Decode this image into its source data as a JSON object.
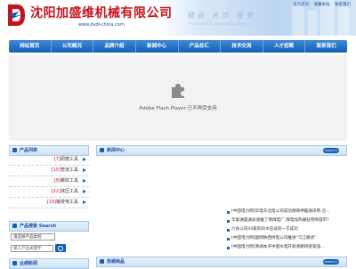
{
  "header": {
    "company_name": "沈阳加盛维机械有限公司",
    "site_url": "www.dvdl-china.com",
    "slogan": "精益 合作 服务",
    "slogan_sub": "Precision   Cooperation   Service",
    "top_links": [
      "设为首页",
      "收藏本站",
      "联系我们"
    ]
  },
  "nav": {
    "items": [
      "网站首页",
      "公司概况",
      "品牌介绍",
      "新闻中心",
      "产品总汇",
      "技术交流",
      "人才招聘",
      "联系我们"
    ]
  },
  "flash": {
    "message": "Adobe Flash Player 已不再受支持"
  },
  "categories": {
    "title": "产品列表",
    "items": [
      {
        "count": "[7]",
        "label": "研磨工具"
      },
      {
        "count": "[15]",
        "label": "管道工具"
      },
      {
        "count": "[8]",
        "label": "螺纹工具"
      },
      {
        "count": "[22]",
        "label": "液压工具"
      },
      {
        "count": "[19]",
        "label": "输变电工具"
      }
    ]
  },
  "search": {
    "title": "产品搜索 Search",
    "select_value": "请选择产品类别",
    "input_placeholder": "输入产品关键字"
  },
  "contact": {
    "title": "业绩新闻"
  },
  "news": {
    "title": "新闻中心",
    "more": "more>>",
    "items": [
      "[中国电力网]华电东北电公司成功保障供暖通讯用 迅...",
      "华能通盛通加速推了燃煤电厂 煤电加热器钻完降城市?",
      "六省公司44家的的水压试验一次成功",
      "[中国电力网]国网陕西供电公司推进“乌江模式”",
      "[中国电力网]清湖本牙中国水电开发清路将逐渐强..."
    ]
  },
  "hot_products": {
    "title": "热销商品",
    "more": "more>>"
  }
}
